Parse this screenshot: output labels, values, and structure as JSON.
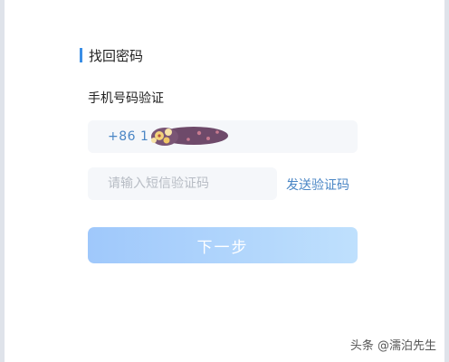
{
  "section": {
    "title": "找回密码"
  },
  "form": {
    "phone_label": "手机号码验证",
    "phone_value": "+86  1",
    "code_placeholder": "请输入短信验证码",
    "send_code_label": "发送验证码",
    "next_label": "下一步"
  },
  "watermark": "头条 @濡泊先生",
  "colors": {
    "accent": "#3a8ee6",
    "link": "#4a86c5",
    "field_bg": "#f5f7fa"
  }
}
